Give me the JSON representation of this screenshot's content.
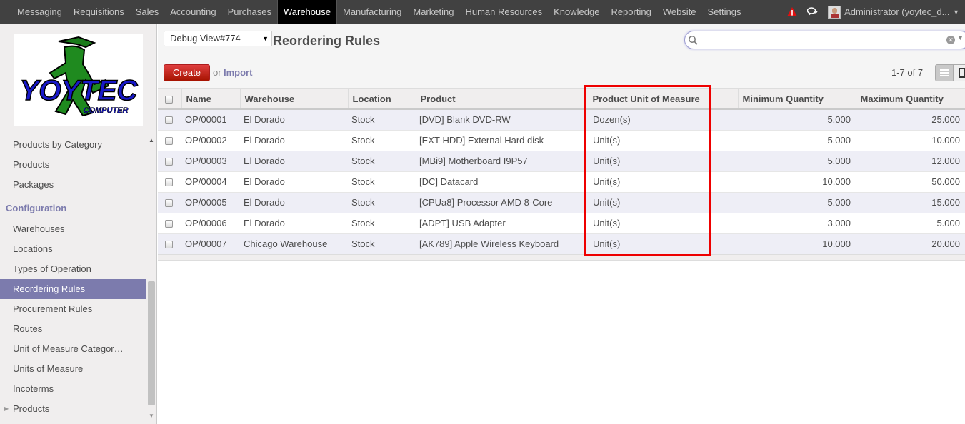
{
  "topbar": {
    "menu": [
      "Messaging",
      "Requisitions",
      "Sales",
      "Accounting",
      "Purchases",
      "Warehouse",
      "Manufacturing",
      "Marketing",
      "Human Resources",
      "Knowledge",
      "Reporting",
      "Website",
      "Settings"
    ],
    "active": "Warehouse",
    "user": "Administrator (yoytec_d..."
  },
  "logo": {
    "text": "YOYTEC",
    "subtext": "COMPUTER"
  },
  "sidebar": {
    "items_top": [
      "Products by Category",
      "Products",
      "Packages"
    ],
    "section": "Configuration",
    "items_config": [
      "Warehouses",
      "Locations",
      "Types of Operation",
      "Reordering Rules",
      "Procurement Rules",
      "Routes",
      "Unit of Measure Categor…",
      "Units of Measure",
      "Incoterms"
    ],
    "active": "Reordering Rules",
    "items_bottom": [
      "Products"
    ]
  },
  "control": {
    "debug_view": "Debug View#774",
    "title": "Reordering Rules",
    "search_value": "",
    "create_label": "Create",
    "or_label": "or",
    "import_label": "Import",
    "pager": "1-7 of 7"
  },
  "table": {
    "columns": [
      "Name",
      "Warehouse",
      "Location",
      "Product",
      "Product Unit of Measure",
      "Minimum Quantity",
      "Maximum Quantity"
    ],
    "rows": [
      [
        "OP/00001",
        "El Dorado",
        "Stock",
        "[DVD] Blank DVD-RW",
        "Dozen(s)",
        "5.000",
        "25.000"
      ],
      [
        "OP/00002",
        "El Dorado",
        "Stock",
        "[EXT-HDD] External Hard disk",
        "Unit(s)",
        "5.000",
        "10.000"
      ],
      [
        "OP/00003",
        "El Dorado",
        "Stock",
        "[MBi9] Motherboard I9P57",
        "Unit(s)",
        "5.000",
        "12.000"
      ],
      [
        "OP/00004",
        "El Dorado",
        "Stock",
        "[DC] Datacard",
        "Unit(s)",
        "10.000",
        "50.000"
      ],
      [
        "OP/00005",
        "El Dorado",
        "Stock",
        "[CPUa8] Processor AMD 8-Core",
        "Unit(s)",
        "5.000",
        "15.000"
      ],
      [
        "OP/00006",
        "El Dorado",
        "Stock",
        "[ADPT] USB Adapter",
        "Unit(s)",
        "3.000",
        "5.000"
      ],
      [
        "OP/00007",
        "Chicago Warehouse",
        "Stock",
        "[AK789] Apple Wireless Keyboard",
        "Unit(s)",
        "10.000",
        "20.000"
      ]
    ]
  },
  "colors": {
    "accent": "#7c7bad",
    "create": "#c02a2a",
    "highlight": "#e00000"
  }
}
